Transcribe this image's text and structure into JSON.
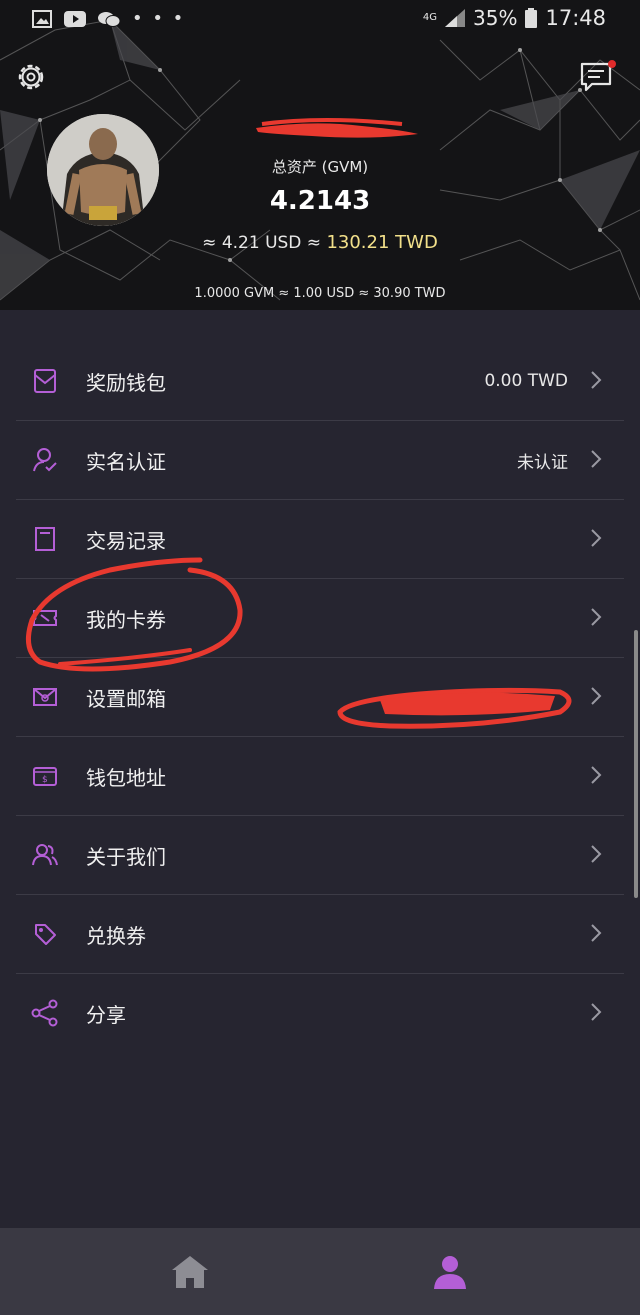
{
  "status_bar": {
    "network": "4G",
    "battery": "35%",
    "time": "17:48"
  },
  "header": {
    "asset_label": "总资产 (GVM)",
    "asset_value": "4.2143",
    "usd_prefix": "≈ 4.21 USD ≈ ",
    "twd_value": "130.21 TWD",
    "rate": "1.0000 GVM ≈ 1.00 USD ≈ 30.90 TWD"
  },
  "menu": [
    {
      "label": "奖励钱包",
      "value": "0.00 TWD"
    },
    {
      "label": "实名认证",
      "value": "未认证"
    },
    {
      "label": "交易记录",
      "value": ""
    },
    {
      "label": "我的卡券",
      "value": ""
    },
    {
      "label": "设置邮箱",
      "value": ""
    },
    {
      "label": "钱包地址",
      "value": ""
    },
    {
      "label": "关于我们",
      "value": ""
    },
    {
      "label": "兑换券",
      "value": ""
    },
    {
      "label": "分享",
      "value": ""
    }
  ],
  "icons": [
    "gear-icon",
    "chat-icon",
    "mail-icon",
    "person-check-icon",
    "notebook-icon",
    "ticket-icon",
    "email-at-icon",
    "wallet-icon",
    "people-icon",
    "tag-icon",
    "share-icon",
    "home-icon",
    "profile-icon"
  ],
  "colors": {
    "accent": "#b45fd6",
    "twd_highlight": "#f2e08a",
    "background": "#262530",
    "header": "#141416"
  }
}
